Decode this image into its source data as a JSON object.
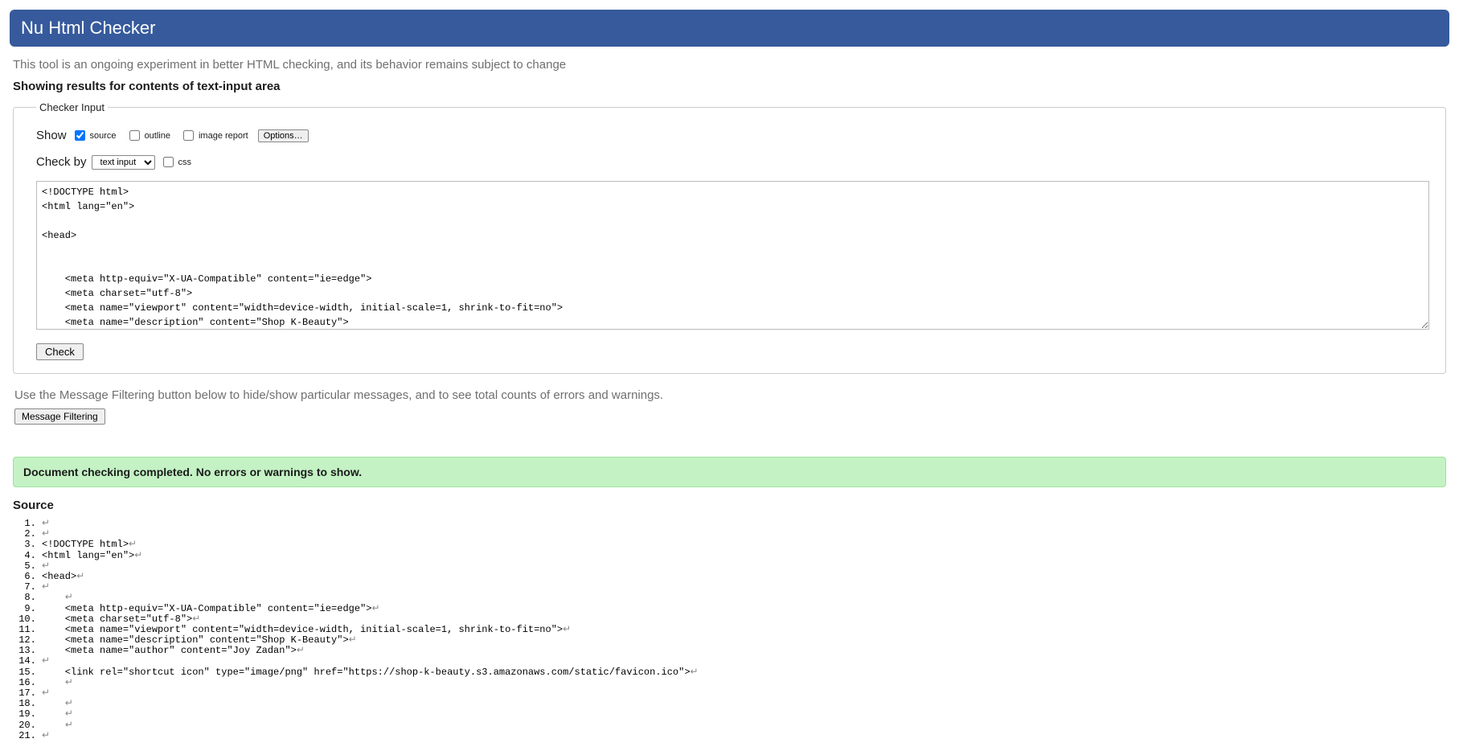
{
  "banner": {
    "title": "Nu Html Checker"
  },
  "disclaimer": "This tool is an ongoing experiment in better HTML checking, and its behavior remains subject to change",
  "results_heading": "Showing results for contents of text-input area",
  "checker": {
    "legend": "Checker Input",
    "show_label": "Show",
    "checkboxes": {
      "source": "source",
      "outline": "outline",
      "image_report": "image report"
    },
    "options_button": "Options…",
    "check_by_label": "Check by",
    "check_by_selected": "text input",
    "css_label": "css",
    "textarea_value": "<!DOCTYPE html>\n<html lang=\"en\">\n\n<head>\n\n\n    <meta http-equiv=\"X-UA-Compatible\" content=\"ie=edge\">\n    <meta charset=\"utf-8\">\n    <meta name=\"viewport\" content=\"width=device-width, initial-scale=1, shrink-to-fit=no\">\n    <meta name=\"description\" content=\"Shop K-Beauty\">\n    <meta name=\"author\" content=\"Joy Zadan\">\n\n    <link rel=\"shortcut icon\" type=\"image/png\" href=\"https://shop-k-beauty.s3.amazonaws.com/static/favicon.ico\">",
    "check_button": "Check"
  },
  "filter_note": "Use the Message Filtering button below to hide/show particular messages, and to see total counts of errors and warnings.",
  "message_filtering_button": "Message Filtering",
  "success_message": "Document checking completed. No errors or warnings to show.",
  "source_heading": "Source",
  "return_glyph": "↵",
  "source_lines": [
    "",
    "",
    "<!DOCTYPE html>",
    "<html lang=\"en\">",
    "",
    "<head>",
    "",
    "    ",
    "    <meta http-equiv=\"X-UA-Compatible\" content=\"ie=edge\">",
    "    <meta charset=\"utf-8\">",
    "    <meta name=\"viewport\" content=\"width=device-width, initial-scale=1, shrink-to-fit=no\">",
    "    <meta name=\"description\" content=\"Shop K-Beauty\">",
    "    <meta name=\"author\" content=\"Joy Zadan\">",
    "",
    "    <link rel=\"shortcut icon\" type=\"image/png\" href=\"https://shop-k-beauty.s3.amazonaws.com/static/favicon.ico\">",
    "    ",
    "",
    "    ",
    "    ",
    "    ",
    ""
  ]
}
